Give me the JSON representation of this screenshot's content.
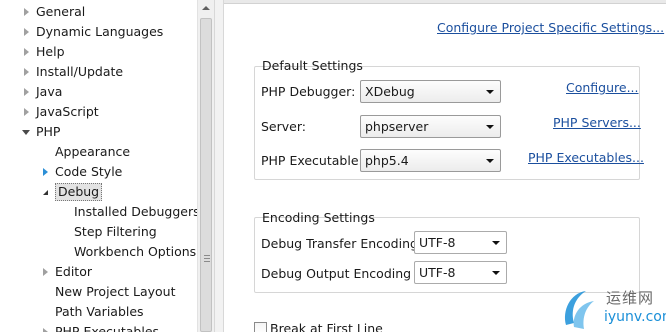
{
  "tree": {
    "items": [
      {
        "label": "General",
        "toggle": "collapsed"
      },
      {
        "label": "Dynamic Languages",
        "toggle": "collapsed"
      },
      {
        "label": "Help",
        "toggle": "collapsed"
      },
      {
        "label": "Install/Update",
        "toggle": "collapsed"
      },
      {
        "label": "Java",
        "toggle": "collapsed"
      },
      {
        "label": "JavaScript",
        "toggle": "collapsed"
      },
      {
        "label": "PHP",
        "toggle": "expanded"
      },
      {
        "label": "Appearance",
        "toggle": "none"
      },
      {
        "label": "Code Style",
        "toggle": "collapsed-blue"
      },
      {
        "label": "Debug",
        "toggle": "expanded",
        "selected": true
      },
      {
        "label": "Installed Debuggers",
        "toggle": "none"
      },
      {
        "label": "Step Filtering",
        "toggle": "none"
      },
      {
        "label": "Workbench Options",
        "toggle": "none"
      },
      {
        "label": "Editor",
        "toggle": "collapsed"
      },
      {
        "label": "New Project Layout",
        "toggle": "none"
      },
      {
        "label": "Path Variables",
        "toggle": "none"
      },
      {
        "label": "PHP Executables",
        "toggle": "collapsed"
      }
    ]
  },
  "right": {
    "project_link": "Configure Project Specific Settings...",
    "default_settings": {
      "title": "Default Settings",
      "rows": [
        {
          "label": "PHP Debugger:",
          "value": "XDebug",
          "link": "Configure..."
        },
        {
          "label": "Server:",
          "value": "phpserver",
          "link": "PHP Servers..."
        },
        {
          "label": "PHP Executable:",
          "value": "php5.4",
          "link": "PHP Executables..."
        }
      ]
    },
    "encoding_settings": {
      "title": "Encoding Settings",
      "rows": [
        {
          "label": "Debug Transfer Encoding",
          "value": "UTF-8"
        },
        {
          "label": "Debug Output Encoding",
          "value": "UTF-8"
        }
      ]
    },
    "break_first_line": "Break at First Line"
  },
  "watermark": {
    "cn": "运维网",
    "en": "iyunv.com"
  }
}
